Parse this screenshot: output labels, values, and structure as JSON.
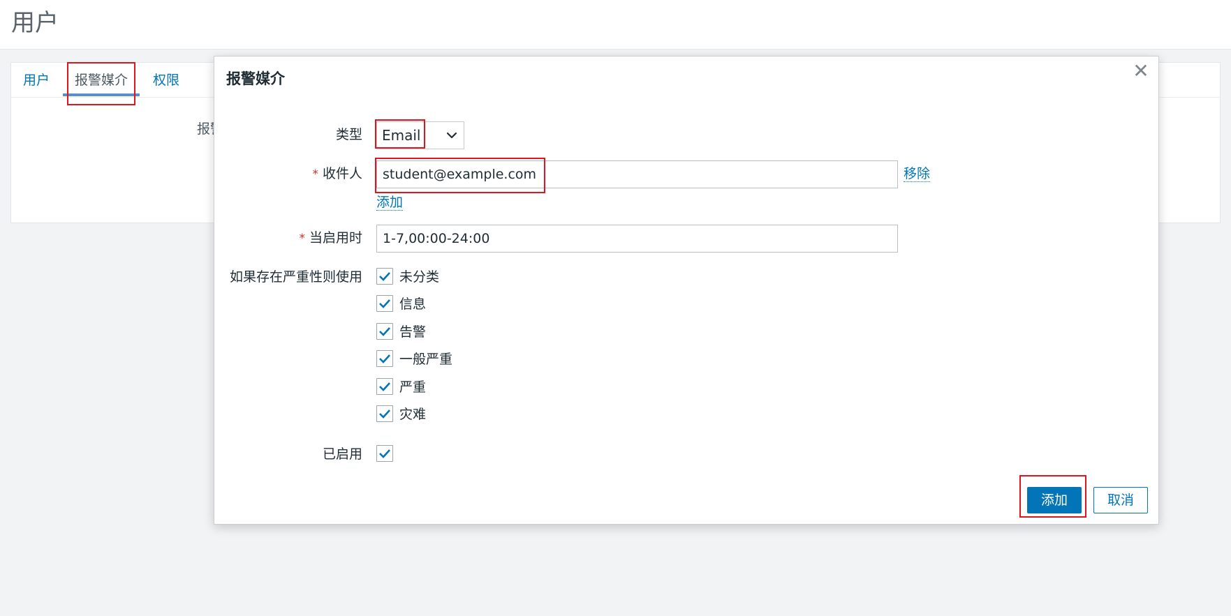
{
  "page": {
    "title": "用户"
  },
  "tabs": [
    {
      "label": "用户"
    },
    {
      "label": "报警媒介"
    },
    {
      "label": "权限"
    }
  ],
  "background_form": {
    "label_fragment": "报警媒介"
  },
  "dialog": {
    "title": "报警媒介",
    "close_symbol": "✕",
    "type": {
      "label": "类型",
      "value": "Email"
    },
    "recipient": {
      "label": "收件人",
      "required_marker": "*",
      "value": "student@example.com",
      "remove_link": "移除",
      "add_link": "添加"
    },
    "when_active": {
      "label": "当启用时",
      "required_marker": "*",
      "value": "1-7,00:00-24:00"
    },
    "severity": {
      "label": "如果存在严重性则使用",
      "options": [
        {
          "label": "未分类",
          "checked": true
        },
        {
          "label": "信息",
          "checked": true
        },
        {
          "label": "告警",
          "checked": true
        },
        {
          "label": "一般严重",
          "checked": true
        },
        {
          "label": "严重",
          "checked": true
        },
        {
          "label": "灾难",
          "checked": true
        }
      ]
    },
    "enabled": {
      "label": "已启用",
      "checked": true
    },
    "buttons": {
      "add": "添加",
      "cancel": "取消"
    }
  },
  "colors": {
    "accent": "#0275b8",
    "highlight": "#e0141e",
    "required": "#d72c2c"
  }
}
